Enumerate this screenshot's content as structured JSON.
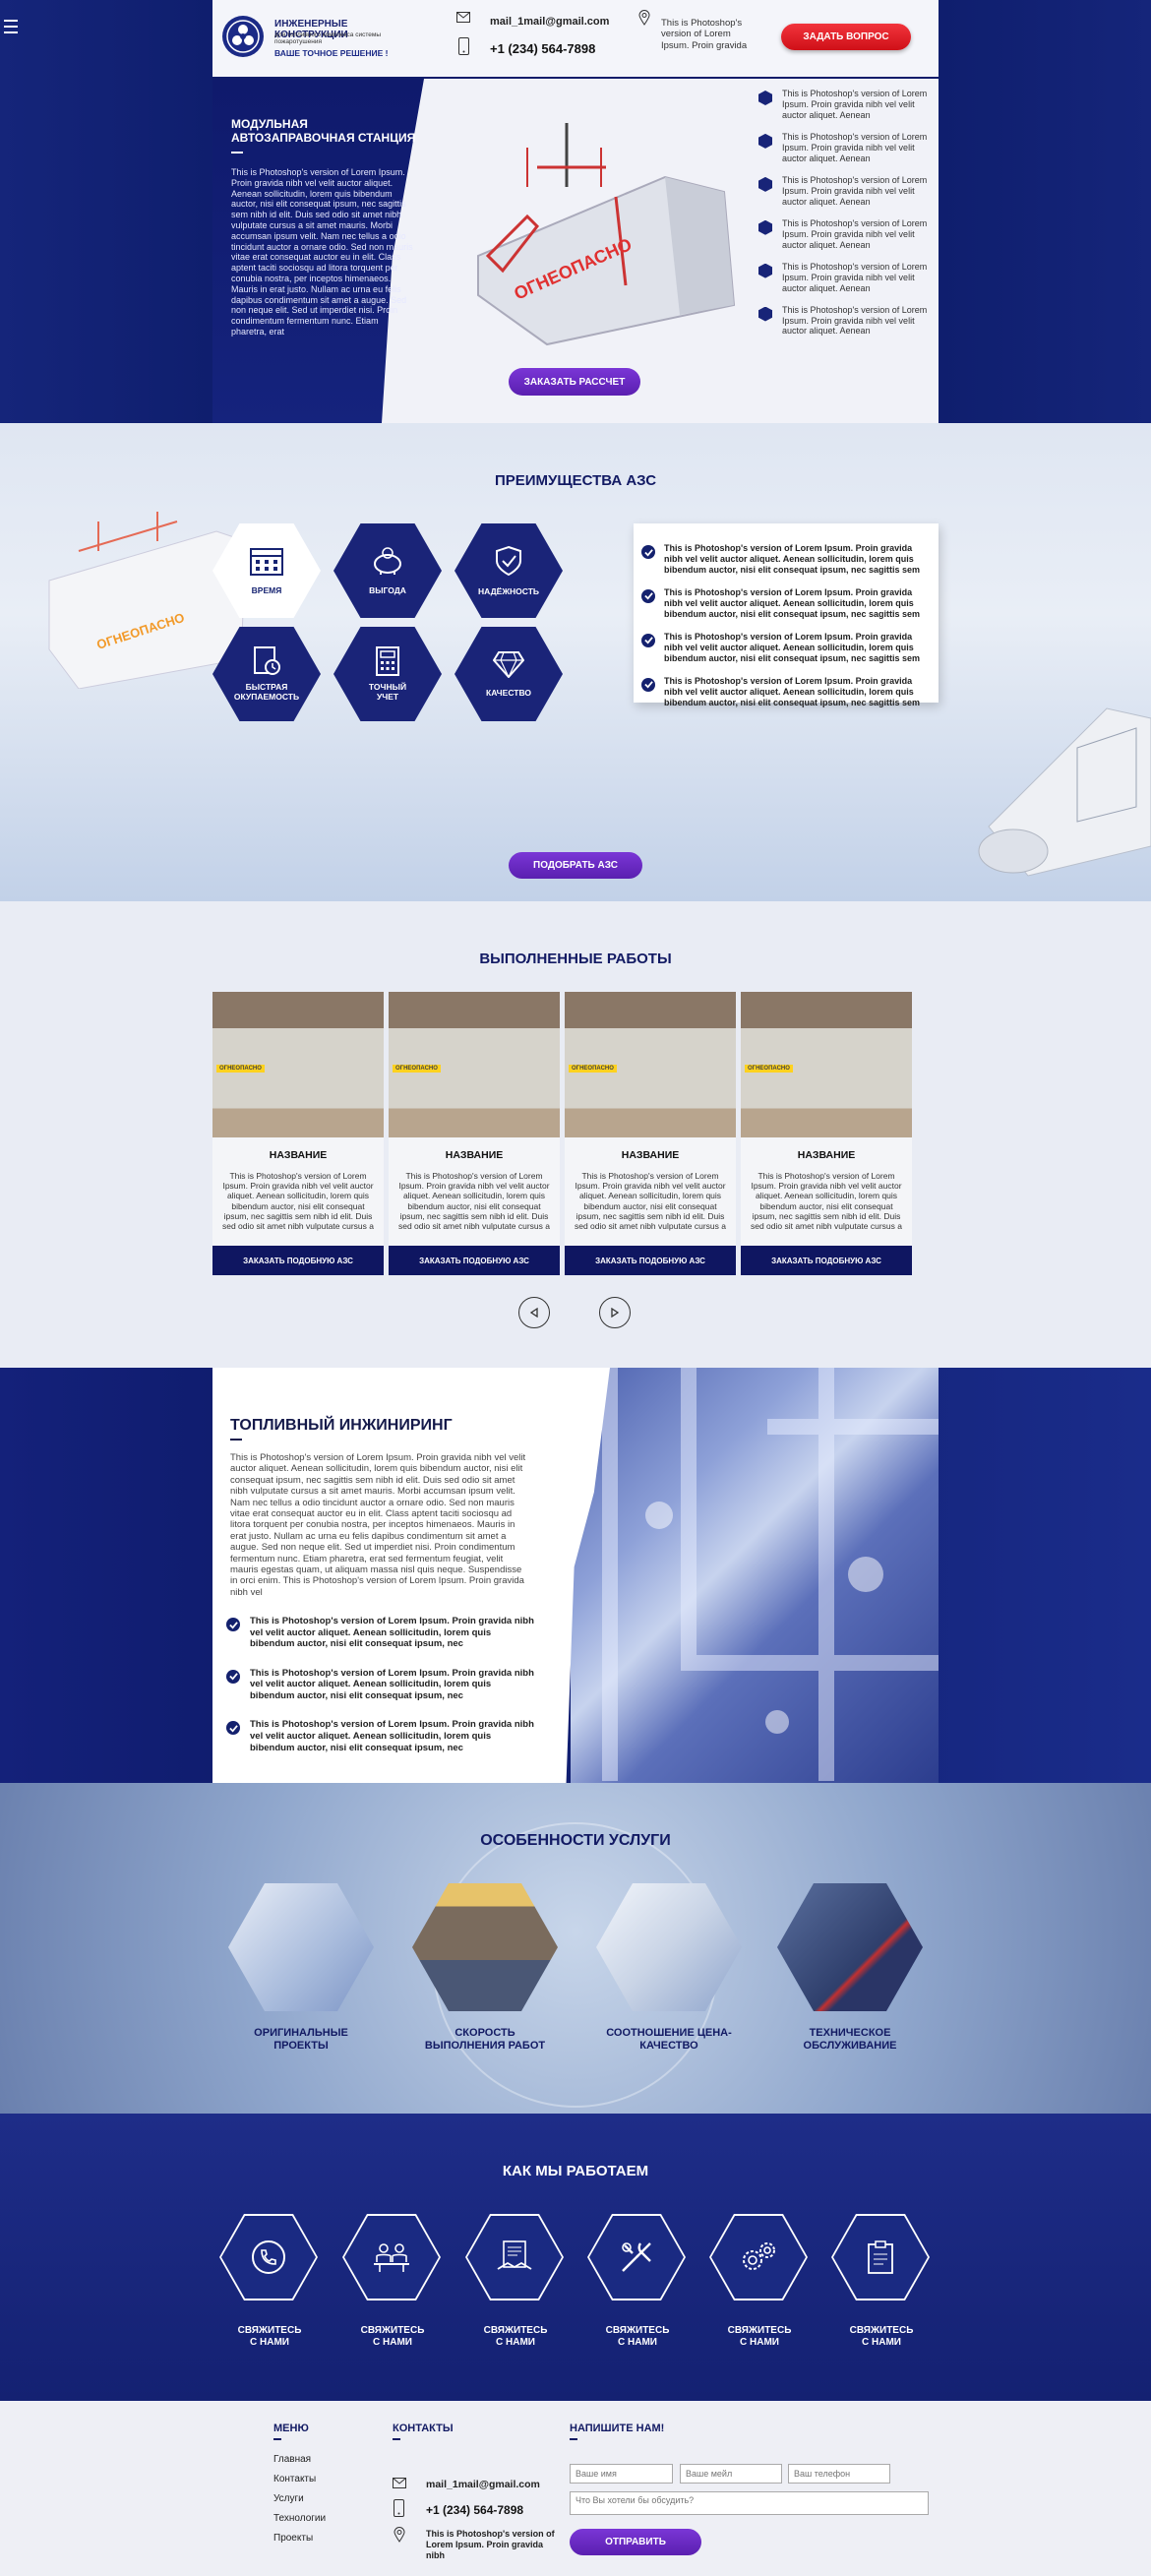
{
  "menu_icon": "hamburger-icon",
  "header": {
    "logo_title": "ИНЖЕНЕРНЫЕ КОНСТРУКЦИИ",
    "logo_sub": "для топливного комплекса системы пожаротушения",
    "logo_slogan": "ВАШЕ ТОЧНОЕ РЕШЕНИЕ !",
    "email": "mail_1mail@gmail.com",
    "phone": "+1 (234) 564-7898",
    "address": "This is Photoshop's version of Lorem Ipsum. Proin gravida",
    "ask_button": "ЗАДАТЬ ВОПРОС"
  },
  "hero": {
    "title": "МОДУЛЬНАЯ АВТОЗАПРАВОЧНАЯ СТАНЦИЯ",
    "text": "This is Photoshop's version of Lorem Ipsum. Proin gravida nibh vel velit auctor aliquet. Aenean sollicitudin, lorem quis bibendum auctor, nisi elit consequat ipsum, nec sagittis sem nibh id elit. Duis sed odio sit amet nibh vulputate cursus a sit amet mauris. Morbi accumsan ipsum velit. Nam nec tellus a odio tincidunt auctor a ornare odio. Sed non mauris vitae erat consequat auctor eu in elit. Class aptent taciti sociosqu ad litora torquent per conubia nostra, per inceptos himenaeos. Mauris in erat justo. Nullam ac urna eu felis dapibus condimentum sit amet a augue. Sed non neque elit. Sed ut imperdiet nisi. Proin condimentum fermentum nunc. Etiam pharetra, erat",
    "tank_label": "ОГНЕОПАСНО",
    "order_button": "ЗАКАЗАТЬ РАССЧЕТ",
    "features": [
      "This is Photoshop's version of Lorem Ipsum. Proin gravida nibh vel velit auctor aliquet. Aenean",
      "This is Photoshop's version of Lorem Ipsum. Proin gravida nibh vel velit auctor aliquet. Aenean",
      "This is Photoshop's version of Lorem Ipsum. Proin gravida nibh vel velit auctor aliquet. Aenean",
      "This is Photoshop's version of Lorem Ipsum. Proin gravida nibh vel velit auctor aliquet. Aenean",
      "This is Photoshop's version of Lorem Ipsum. Proin gravida nibh vel velit auctor aliquet. Aenean",
      "This is Photoshop's version of Lorem Ipsum. Proin gravida nibh vel velit auctor aliquet. Aenean"
    ]
  },
  "advantages": {
    "title": "ПРЕИМУЩЕСТВА АЗС",
    "tank_label": "ОГНЕОПАСНО",
    "items": [
      {
        "label": "ВРЕМЯ",
        "icon": "calendar-icon"
      },
      {
        "label": "ВЫГОДА",
        "icon": "piggy-bank-icon"
      },
      {
        "label": "НАДЁЖНОСТЬ",
        "icon": "shield-check-icon"
      },
      {
        "label": "БЫСТРАЯ ОКУПАЕМОСТЬ",
        "icon": "document-clock-icon"
      },
      {
        "label": "ТОЧНЫЙ УЧЕТ",
        "icon": "calculator-icon"
      },
      {
        "label": "КАЧЕСТВО",
        "icon": "diamond-icon"
      }
    ],
    "points": [
      "This is Photoshop's version of Lorem Ipsum. Proin gravida nibh vel velit auctor aliquet. Aenean sollicitudin, lorem quis bibendum auctor, nisi elit consequat ipsum, nec sagittis sem",
      "This is Photoshop's version of Lorem Ipsum. Proin gravida nibh vel velit auctor aliquet. Aenean sollicitudin, lorem quis bibendum auctor, nisi elit consequat ipsum, nec sagittis sem",
      "This is Photoshop's version of Lorem Ipsum. Proin gravida nibh vel velit auctor aliquet. Aenean sollicitudin, lorem quis bibendum auctor, nisi elit consequat ipsum, nec sagittis sem",
      "This is Photoshop's version of Lorem Ipsum. Proin gravida nibh vel velit auctor aliquet. Aenean sollicitudin, lorem quis bibendum auctor, nisi elit consequat ipsum, nec sagittis sem"
    ],
    "button": "ПОДОБРАТЬ АЗС"
  },
  "works": {
    "title": "ВЫПОЛНЕННЫЕ РАБОТЫ",
    "photo_label": "ОГНЕОПАСНО",
    "cards": [
      {
        "name": "НАЗВАНИЕ",
        "text": "This is Photoshop's version of Lorem Ipsum. Proin gravida nibh vel velit auctor aliquet. Aenean sollicitudin, lorem quis bibendum auctor, nisi elit consequat ipsum, nec sagittis sem nibh id elit. Duis sed odio sit amet nibh vulputate cursus a",
        "button": "ЗАКАЗАТЬ ПОДОБНУЮ АЗС"
      },
      {
        "name": "НАЗВАНИЕ",
        "text": "This is Photoshop's version of Lorem Ipsum. Proin gravida nibh vel velit auctor aliquet. Aenean sollicitudin, lorem quis bibendum auctor, nisi elit consequat ipsum, nec sagittis sem nibh id elit. Duis sed odio sit amet nibh vulputate cursus a",
        "button": "ЗАКАЗАТЬ ПОДОБНУЮ АЗС"
      },
      {
        "name": "НАЗВАНИЕ",
        "text": "This is Photoshop's version of Lorem Ipsum. Proin gravida nibh vel velit auctor aliquet. Aenean sollicitudin, lorem quis bibendum auctor, nisi elit consequat ipsum, nec sagittis sem nibh id elit. Duis sed odio sit amet nibh vulputate cursus a",
        "button": "ЗАКАЗАТЬ ПОДОБНУЮ АЗС"
      },
      {
        "name": "НАЗВАНИЕ",
        "text": "This is Photoshop's version of Lorem Ipsum. Proin gravida nibh vel velit auctor aliquet. Aenean sollicitudin, lorem quis bibendum auctor, nisi elit consequat ipsum, nec sagittis sem nibh id elit. Duis sed odio sit amet nibh vulputate cursus a",
        "button": "ЗАКАЗАТЬ ПОДОБНУЮ АЗС"
      }
    ]
  },
  "engineering": {
    "title": "ТОПЛИВНЫЙ ИНЖИНИРИНГ",
    "text": "This is Photoshop's version of Lorem Ipsum. Proin gravida nibh vel velit auctor aliquet. Aenean sollicitudin, lorem quis bibendum auctor, nisi elit consequat ipsum, nec sagittis sem nibh id elit. Duis sed odio sit amet nibh vulputate cursus a sit amet mauris. Morbi accumsan ipsum velit. Nam nec tellus a odio tincidunt auctor a ornare odio. Sed non mauris vitae erat consequat auctor eu in elit. Class aptent taciti sociosqu ad litora torquent per conubia nostra, per inceptos himenaeos. Mauris in erat justo. Nullam ac urna eu felis dapibus condimentum sit amet a augue. Sed non neque elit. Sed ut imperdiet nisi. Proin condimentum fermentum nunc. Etiam pharetra, erat sed fermentum feugiat, velit mauris egestas quam, ut aliquam massa nisl quis neque. Suspendisse in orci enim. This is Photoshop's version of Lorem Ipsum. Proin gravida nibh vel",
    "points": [
      "This is Photoshop's version of Lorem Ipsum. Proin gravida nibh vel velit auctor aliquet. Aenean sollicitudin, lorem quis bibendum auctor, nisi elit consequat ipsum, nec",
      "This is Photoshop's version of Lorem Ipsum. Proin gravida nibh vel velit auctor aliquet. Aenean sollicitudin, lorem quis bibendum auctor, nisi elit consequat ipsum, nec",
      "This is Photoshop's version of Lorem Ipsum. Proin gravida nibh vel velit auctor aliquet. Aenean sollicitudin, lorem quis bibendum auctor, nisi elit consequat ipsum, nec"
    ]
  },
  "service": {
    "title": "ОСОБЕННОСТИ УСЛУГИ",
    "items": [
      {
        "label": "ОРИГИНАЛЬНЫЕ ПРОЕКТЫ"
      },
      {
        "label": "СКОРОСТЬ ВЫПОЛНЕНИЯ РАБОТ"
      },
      {
        "label": "СООТНОШЕНИЕ ЦЕНА-КАЧЕСТВО"
      },
      {
        "label": "ТЕХНИЧЕСКОЕ ОБСЛУЖИВАНИЕ"
      }
    ]
  },
  "howwework": {
    "title": "КАК МЫ РАБОТАЕМ",
    "steps": [
      {
        "label": "СВЯЖИТЕСЬ С НАМИ",
        "icon": "phone-icon"
      },
      {
        "label": "СВЯЖИТЕСЬ С НАМИ",
        "icon": "meeting-icon"
      },
      {
        "label": "СВЯЖИТЕСЬ С НАМИ",
        "icon": "contract-handshake-icon"
      },
      {
        "label": "СВЯЖИТЕСЬ С НАМИ",
        "icon": "tools-icon"
      },
      {
        "label": "СВЯЖИТЕСЬ С НАМИ",
        "icon": "gears-icon"
      },
      {
        "label": "СВЯЖИТЕСЬ С НАМИ",
        "icon": "clipboard-icon"
      }
    ]
  },
  "footer": {
    "menu_title": "МЕНЮ",
    "menu": [
      "Главная",
      "Контакты",
      "Услуги",
      "Технологии",
      "Проекты"
    ],
    "contacts_title": "КОНТАКТЫ",
    "email": "mail_1mail@gmail.com",
    "phone": "+1 (234) 564-7898",
    "address": "This is Photoshop's version of Lorem Ipsum. Proin gravida nibh",
    "form_title": "НАПИШИТЕ НАМ!",
    "name_placeholder": "Ваше имя",
    "mail_placeholder": "Ваше мейл",
    "phone_placeholder": "Ваш телефон",
    "message_placeholder": "Что Вы хотели бы обсудить?",
    "send_button": "ОТПРАВИТЬ"
  }
}
